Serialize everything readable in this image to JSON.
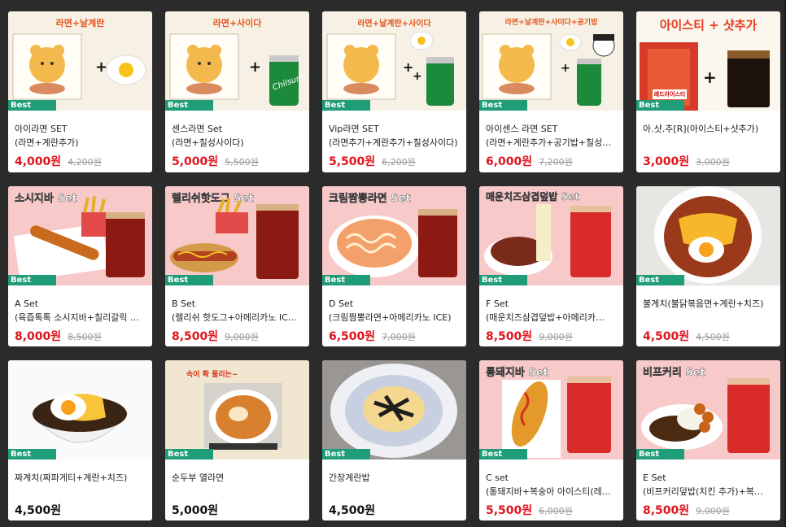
{
  "badge_label": "Best",
  "colors": {
    "badge": "#1f9d78",
    "price": "#e0141e",
    "page_bg": "#2b2b2b"
  },
  "cards": [
    {
      "banner": "라면+날계란",
      "name": "아이라면 SET",
      "desc": "(라면+계란추가)",
      "price": "4,000원",
      "orig": "4,200원"
    },
    {
      "banner": "라면+사이다",
      "name": "센스라면 Set",
      "desc": "(라면+칠성사이다)",
      "price": "5,000원",
      "orig": "5,500원"
    },
    {
      "banner": "라면+날계란+사이다",
      "name": "Vip라면 SET",
      "desc": "(라면추가+계란추가+칠성사이다)",
      "price": "5,500원",
      "orig": "6,200원"
    },
    {
      "banner": "라면+날계란+사이다+공기밥",
      "name": "아이센스 라면 SET",
      "desc": "(라면+계란추가+공기밥+칠성…",
      "price": "6,000원",
      "orig": "7,200원"
    },
    {
      "banner": "아이스티 + 샷추가",
      "label": "레드아이스티",
      "name": "아.샷.추[R](아이스티+샷추가)",
      "desc": "",
      "price": "3,000원",
      "orig": "3,000원"
    },
    {
      "banner": "소시지바 Set",
      "name": "A Set",
      "desc": "(육즙톡톡 소시지바+칠리갈릭 …",
      "price": "8,000원",
      "orig": "8,500원"
    },
    {
      "banner": "렐리쉬핫도그 Set",
      "name": "B Set",
      "desc": "(렐리쉬 핫도그+아메리카노 IC…",
      "price": "8,500원",
      "orig": "9,000원"
    },
    {
      "banner": "크림짬뽕라면 Set",
      "name": "D Set",
      "desc": "(크림짬뽕라면+아메리카노 ICE)",
      "price": "6,500원",
      "orig": "7,000원"
    },
    {
      "banner": "매운치즈삼겹덮밥 Set",
      "name": "F Set",
      "desc": "(매운치즈삼겹덮밥+아메리카…",
      "price": "8,500원",
      "orig": "9,000원"
    },
    {
      "banner": "",
      "name": "불계치(불닭볶음면+계란+치즈)",
      "desc": "",
      "price": "4,500원",
      "orig": "4,500원"
    },
    {
      "banner": "",
      "name": "짜계치(짜파게티+계란+치즈)",
      "desc": "",
      "price": "4,500원",
      "orig": ""
    },
    {
      "banner": "속이 확 풀리는~",
      "name": "순두부 열라면",
      "desc": "",
      "price": "5,000원",
      "orig": ""
    },
    {
      "banner": "",
      "name": "간장계란밥",
      "desc": "",
      "price": "4,500원",
      "orig": ""
    },
    {
      "banner": "통돼지바 Set",
      "name": "C set",
      "desc": "(통돼지바+복숭아 아이스티(레…",
      "price": "5,500원",
      "orig": "6,000원"
    },
    {
      "banner": "비프커리 Set",
      "name": "E Set",
      "desc": "(비프커리덮밥(치킨 추가)+복…",
      "price": "8,500원",
      "orig": "9,000원"
    }
  ]
}
